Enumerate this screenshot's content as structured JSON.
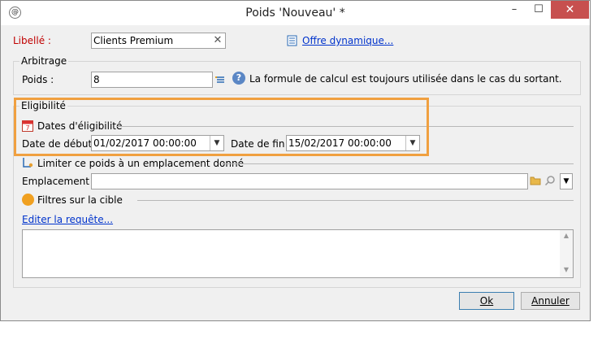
{
  "window": {
    "title": "Poids 'Nouveau' *"
  },
  "titlebar": {
    "minimize": "–",
    "maximize": "☐",
    "close": "✕"
  },
  "libelle": {
    "label": "Libellé :",
    "value": "Clients Premium",
    "clear_icon": "✕"
  },
  "offre": {
    "link": "Offre dynamique..."
  },
  "arbitrage": {
    "legend": "Arbitrage",
    "poids_label": "Poids :",
    "poids_value": "8",
    "help_text": "La formule de calcul est toujours utilisée dans le cas du sortant."
  },
  "eligibilite": {
    "legend": "Eligibilité",
    "dates_header": "Dates d'éligibilité",
    "calendar_number": "7",
    "start_label": "Date de début :",
    "start_value": "01/02/2017 00:00:00",
    "end_label": "Date de fin :",
    "end_value": "15/02/2017 00:00:00",
    "limit_header": "Limiter ce poids à un emplacement donné",
    "emplacement_label": "Emplacement :",
    "emplacement_value": "",
    "filters_header": "Filtres sur la cible",
    "edit_link": "Editer la requête..."
  },
  "footer": {
    "ok": "Ok",
    "cancel": "Annuler"
  },
  "colors": {
    "highlight": "#f0a040",
    "close": "#c7504f",
    "link": "#0033cc",
    "required": "#c00000"
  }
}
